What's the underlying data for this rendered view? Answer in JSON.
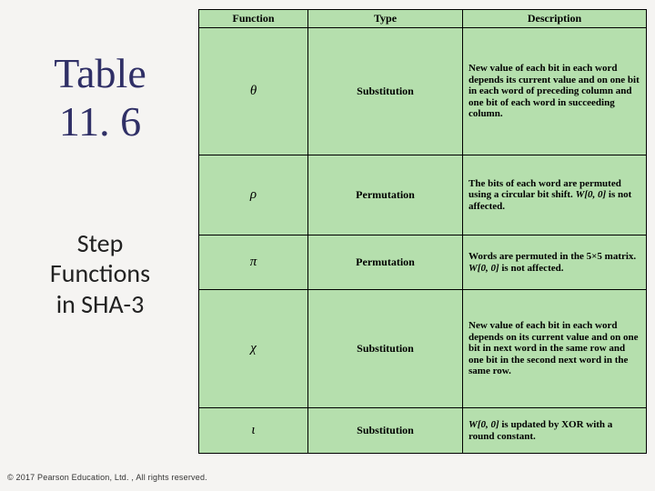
{
  "slide": {
    "title_line1": "Table",
    "title_line2": "11. 6",
    "subtitle_line1": "Step",
    "subtitle_line2": "Functions",
    "subtitle_line3": "in SHA-3",
    "footer": "© 2017 Pearson Education, Ltd. , All rights reserved."
  },
  "table": {
    "headers": {
      "fn": "Function",
      "type": "Type",
      "desc": "Description"
    },
    "rows": [
      {
        "fn": "θ",
        "type": "Substitution",
        "desc": "New value of each bit in each word depends its current value and on one bit in each word of preceding column and one bit of each word in succeeding column."
      },
      {
        "fn": "ρ",
        "type": "Permutation",
        "desc_pre": "The bits of each word are permuted using a circular bit shift. ",
        "desc_mat": "W[0, 0]",
        "desc_post": " is not affected."
      },
      {
        "fn": "π",
        "type": "Permutation",
        "desc_pre": "Words are permuted in the 5×5 matrix. ",
        "desc_mat": "W[0, 0]",
        "desc_post": " is not affected."
      },
      {
        "fn": "χ",
        "type": "Substitution",
        "desc": "New value of each bit in each word depends on its current value and on one bit in next word in the same row and one bit in the second next word in the same row."
      },
      {
        "fn": "ι",
        "type": "Substitution",
        "desc_mat": "W[0, 0]",
        "desc_post": " is updated by XOR with a round constant."
      }
    ]
  },
  "chart_data": {
    "type": "table",
    "title": "Table 11.6 — Step Functions in SHA-3",
    "columns": [
      "Function",
      "Type",
      "Description"
    ],
    "rows": [
      [
        "θ",
        "Substitution",
        "New value of each bit in each word depends its current value and on one bit in each word of preceding column and one bit of each word in succeeding column."
      ],
      [
        "ρ",
        "Permutation",
        "The bits of each word are permuted using a circular bit shift. W[0, 0] is not affected."
      ],
      [
        "π",
        "Permutation",
        "Words are permuted in the 5×5 matrix. W[0, 0] is not affected."
      ],
      [
        "χ",
        "Substitution",
        "New value of each bit in each word depends on its current value and on one bit in next word in the same row and one bit in the second next word in the same row."
      ],
      [
        "ι",
        "Substitution",
        "W[0, 0] is updated by XOR with a round constant."
      ]
    ]
  }
}
